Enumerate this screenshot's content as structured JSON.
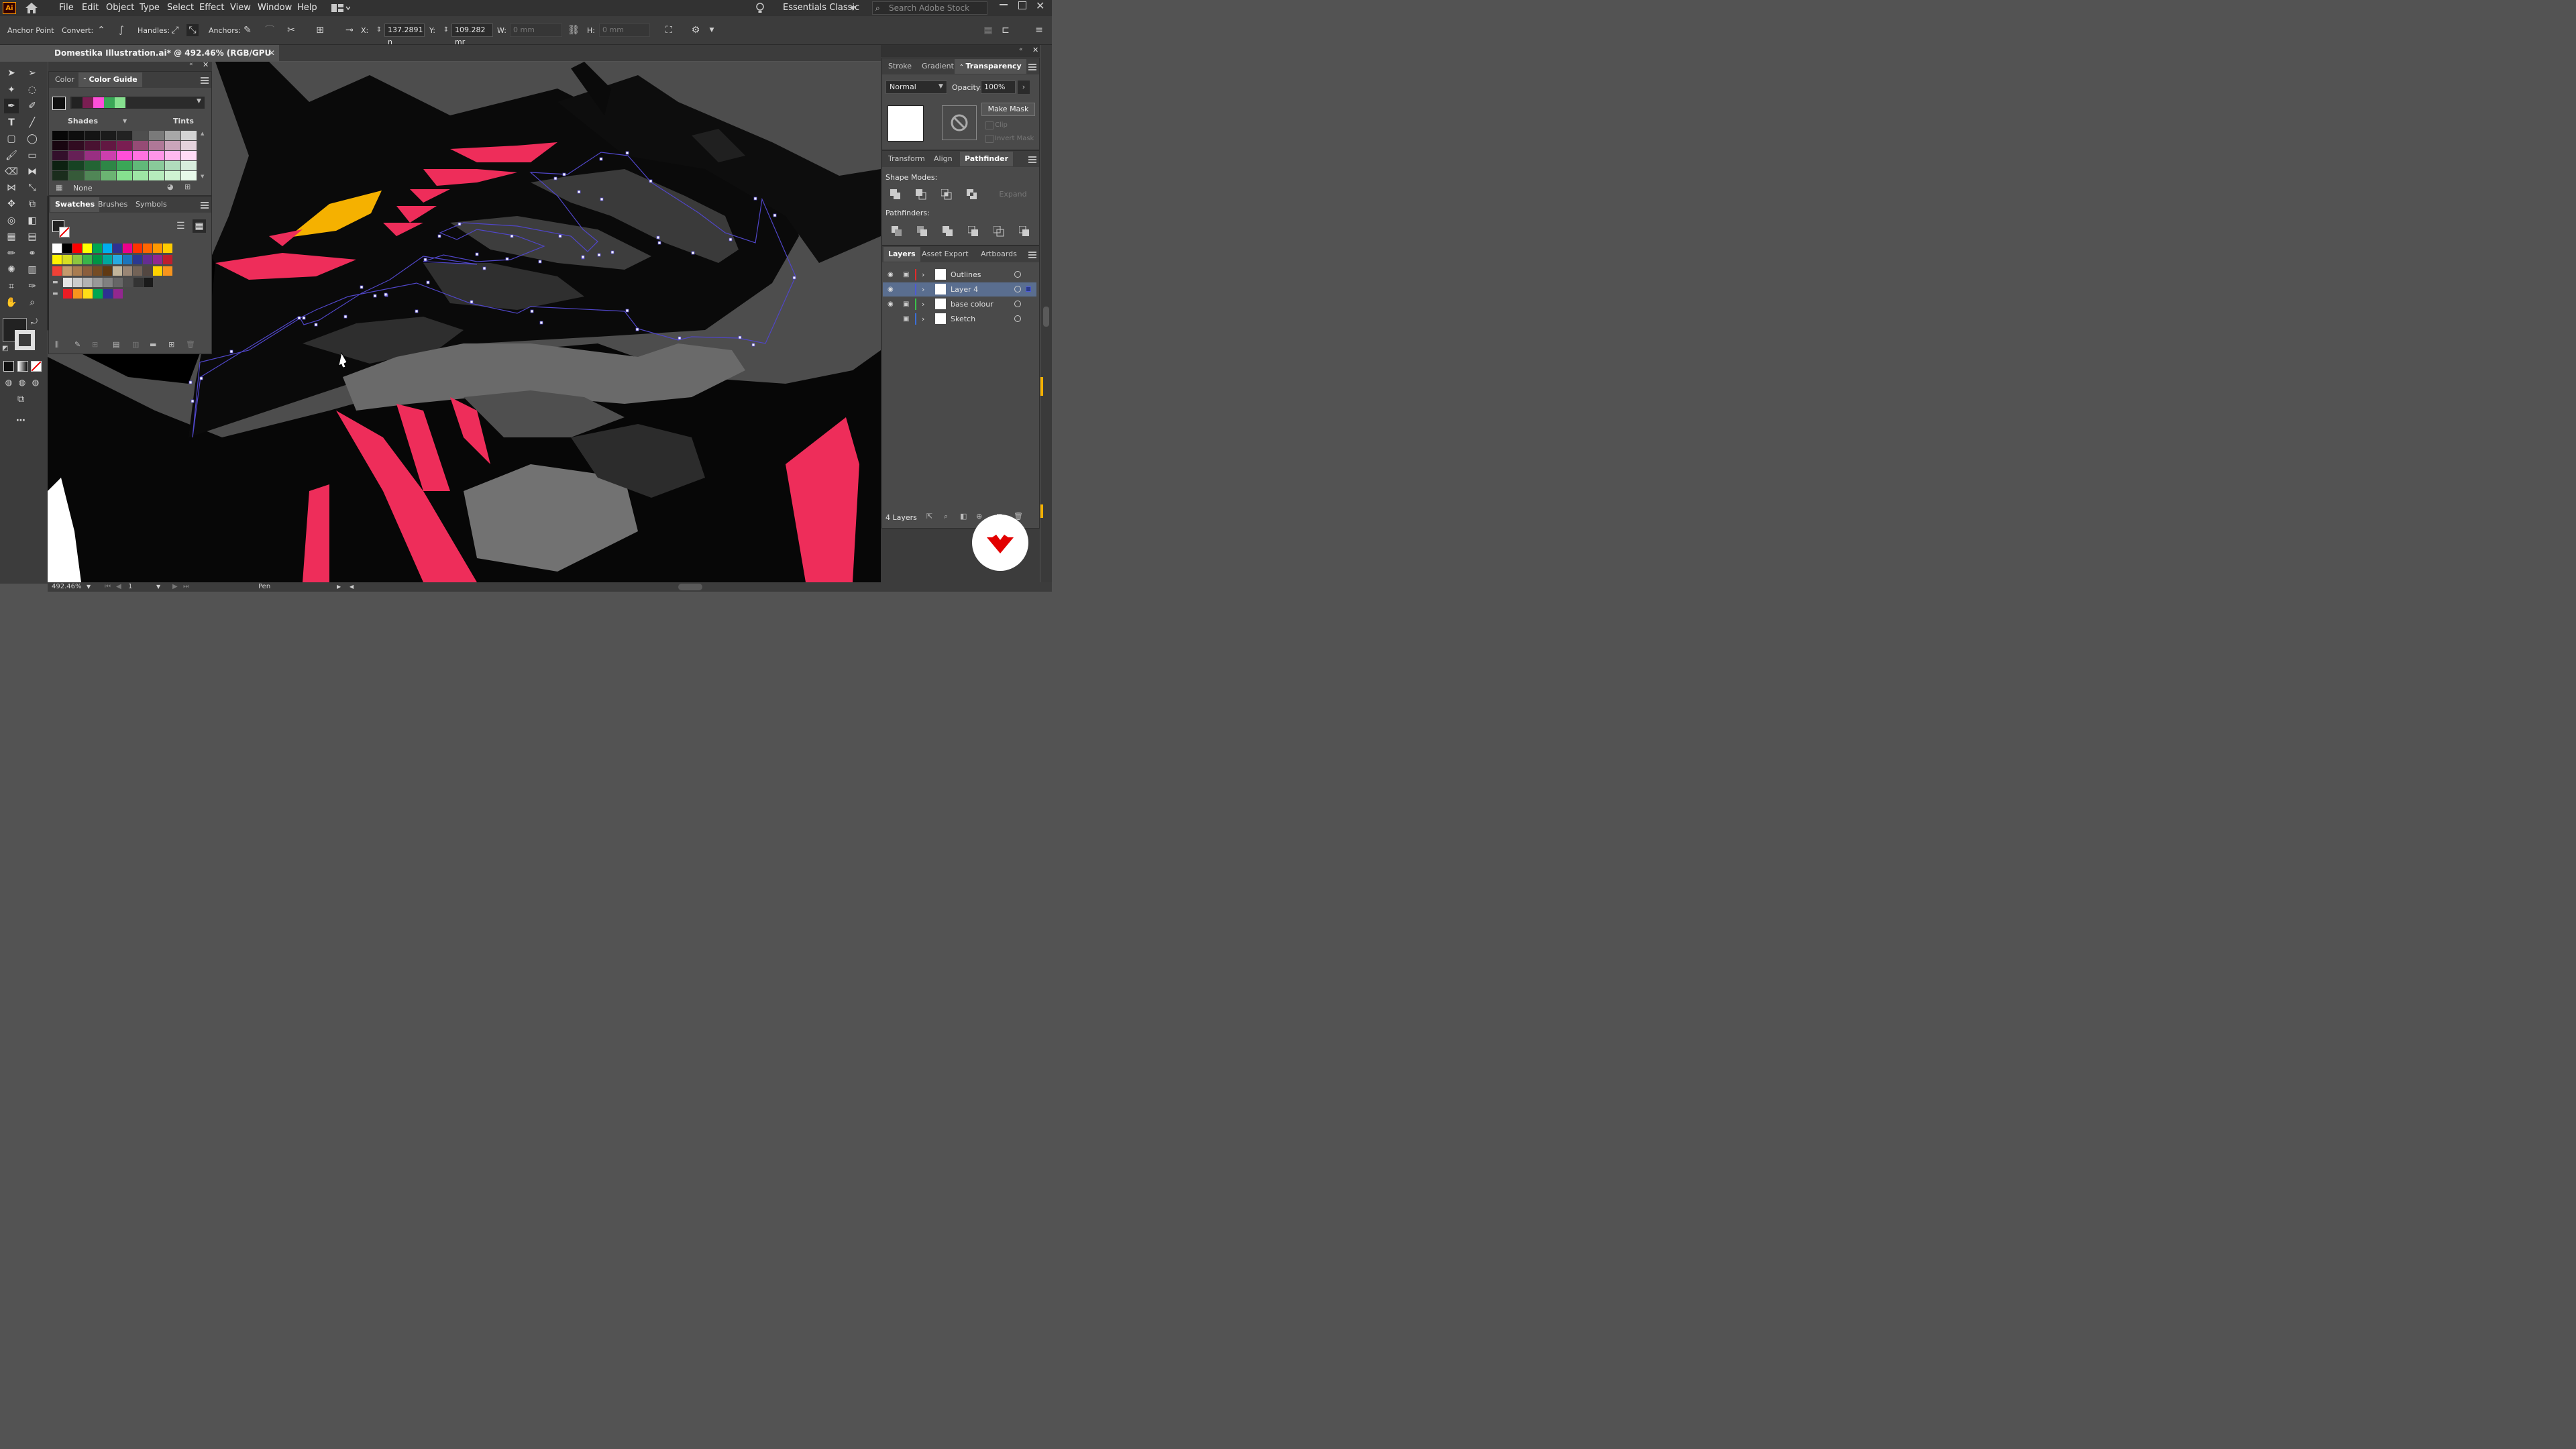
{
  "app": {
    "logo_text": "Ai"
  },
  "menu": {
    "items": [
      "File",
      "Edit",
      "Object",
      "Type",
      "Select",
      "Effect",
      "View",
      "Window",
      "Help"
    ],
    "workspace": "Essentials Classic",
    "search_placeholder": "Search Adobe Stock"
  },
  "control_bar": {
    "tool_name": "Anchor Point",
    "convert_label": "Convert:",
    "handles_label": "Handles:",
    "anchors_label": "Anchors:",
    "x_label": "X:",
    "x_value": "137.2891 n",
    "y_label": "Y:",
    "y_value": "109.282 mr",
    "w_label": "W:",
    "w_value": "0 mm",
    "h_label": "H:",
    "h_value": "0 mm"
  },
  "document": {
    "tab_title": "Domestika Illustration.ai* @ 492.46% (RGB/GPU Preview)"
  },
  "color_panel": {
    "tabs": [
      "Color",
      "Color Guide"
    ],
    "active_tab": "Color Guide",
    "shades_label": "Shades",
    "tints_label": "Tints",
    "none_label": "None",
    "harmony_colors": [
      "#222222",
      "#7a1e52",
      "#ff4fd8",
      "#3aa757",
      "#86e08f"
    ]
  },
  "swatches_panel": {
    "tabs": [
      "Swatches",
      "Brushes",
      "Symbols"
    ],
    "active_tab": "Swatches",
    "row1": [
      "#ffffff",
      "#000000",
      "#ff0000",
      "#ffff00",
      "#00a650",
      "#00aeef",
      "#2e3192",
      "#ec008c",
      "#ff3300",
      "#ff6600",
      "#ff9900",
      "#ffcc00"
    ],
    "row2": [
      "#fff200",
      "#d7df23",
      "#8dc63f",
      "#39b54a",
      "#009444",
      "#00a79d",
      "#27aae1",
      "#1c75bc",
      "#2b3990",
      "#662d91",
      "#92278f",
      "#be1e2d"
    ],
    "row3": [
      "#ef4136",
      "#c49a6c",
      "#a97c50",
      "#8b5e3c",
      "#754c24",
      "#603913",
      "#c2b59b",
      "#998675",
      "#736357",
      "#534741",
      "#ffd200",
      "#f7941d"
    ],
    "row4": [
      "#e6e6e6",
      "#cccccc",
      "#b3b3b3",
      "#999999",
      "#808080",
      "#666666",
      "#4d4d4d",
      "#333333",
      "#1a1a1a"
    ],
    "row5": [
      "#ed1c24",
      "#f7941d",
      "#ffde17",
      "#00a651",
      "#2e3192",
      "#92278f"
    ]
  },
  "right_panel": {
    "top_tabs": [
      "Stroke",
      "Gradient",
      "Transparency"
    ],
    "active_top_tab": "Transparency",
    "blend_mode": "Normal",
    "opacity_label": "Opacity:",
    "opacity_value": "100%",
    "make_mask": "Make Mask",
    "clip_label": "Clip",
    "invert_mask_label": "Invert Mask",
    "mid_tabs": [
      "Transform",
      "Align",
      "Pathfinder"
    ],
    "active_mid_tab": "Pathfinder",
    "shape_modes_label": "Shape Modes:",
    "expand_label": "Expand",
    "pathfinders_label": "Pathfinders:",
    "layer_tabs": [
      "Layers",
      "Asset Export",
      "Artboards"
    ],
    "active_layer_tab": "Layers",
    "layers": [
      {
        "name": "Outlines",
        "color": "#e22b2b",
        "visible": true,
        "locked": true,
        "selected": false
      },
      {
        "name": "Layer 4",
        "color": "#4d5bd6",
        "visible": true,
        "locked": false,
        "selected": true
      },
      {
        "name": "base colour",
        "color": "#3ac24a",
        "visible": true,
        "locked": true,
        "selected": false
      },
      {
        "name": "Sketch",
        "color": "#3b6fd8",
        "visible": false,
        "locked": true,
        "selected": false
      }
    ],
    "layer_count": "4 Layers"
  },
  "status": {
    "zoom": "492.46%",
    "artboard": "1",
    "tool": "Pen"
  }
}
